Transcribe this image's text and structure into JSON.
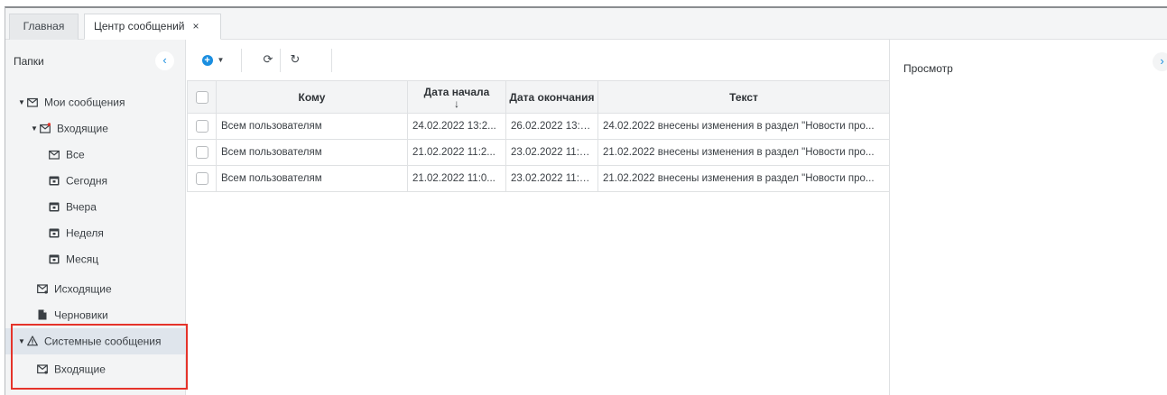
{
  "tabs": [
    {
      "label": "Главная",
      "active": false
    },
    {
      "label": "Центр сообщений",
      "active": true,
      "close": "×"
    }
  ],
  "folders": {
    "title": "Папки",
    "collapse_icon": "chevron-left-icon",
    "items": [
      {
        "label": "Мои сообщения",
        "icon": "mail-open-icon",
        "expanded": true
      },
      {
        "label": "Входящие",
        "icon": "inbox-icon",
        "expanded": true
      },
      {
        "label": "Все",
        "icon": "mail-open-icon"
      },
      {
        "label": "Сегодня",
        "icon": "calendar-icon"
      },
      {
        "label": "Вчера",
        "icon": "calendar-icon"
      },
      {
        "label": "Неделя",
        "icon": "calendar-icon"
      },
      {
        "label": "Месяц",
        "icon": "calendar-icon"
      },
      {
        "label": "Исходящие",
        "icon": "outbox-icon"
      },
      {
        "label": "Черновики",
        "icon": "document-icon"
      },
      {
        "label": "Системные сообщения",
        "icon": "warning-icon",
        "expanded": true,
        "selected": true
      },
      {
        "label": "Входящие",
        "icon": "inbox-icon"
      }
    ]
  },
  "toolbar": {
    "add_icon": "plus-circle-icon",
    "sync_icon": "sync-icon",
    "refresh_icon": "refresh-icon"
  },
  "grid": {
    "columns": [
      {
        "label": "Кому"
      },
      {
        "label": "Дата начала",
        "sort": "desc"
      },
      {
        "label": "Дата окончания"
      },
      {
        "label": "Текст"
      }
    ],
    "rows": [
      {
        "to": "Всем пользователям",
        "start": "24.02.2022 13:2...",
        "end": "26.02.2022 13:2...",
        "text": "24.02.2022 внесены изменения в раздел \"Новости про..."
      },
      {
        "to": "Всем пользователям",
        "start": "21.02.2022 11:2...",
        "end": "23.02.2022 11:2...",
        "text": "21.02.2022 внесены изменения в раздел \"Новости про..."
      },
      {
        "to": "Всем пользователям",
        "start": "21.02.2022 11:0...",
        "end": "23.02.2022 11:0...",
        "text": "21.02.2022 внесены изменения в раздел \"Новости про..."
      }
    ]
  },
  "preview": {
    "title": "Просмотр",
    "expand_icon": "chevron-right-icon"
  },
  "colors": {
    "accent": "#1a8ee0",
    "highlight": "#e5332a",
    "panel_bg": "#f3f4f5",
    "selected_bg": "#dfe5ec"
  }
}
